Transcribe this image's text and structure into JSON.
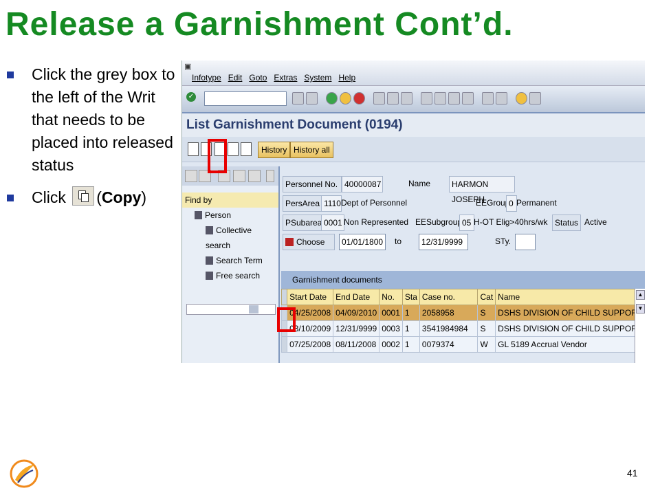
{
  "slide": {
    "title": "Release a Garnishment Cont’d.",
    "bullet1": "Click the grey box to the left of the Writ that needs to be placed into released status",
    "bullet2_pre": "Click ",
    "bullet2_paren_open": "(",
    "bullet2_bold": "Copy",
    "bullet2_paren_close": ")",
    "page_number": "41"
  },
  "sap": {
    "menu": [
      "Infotype",
      "Edit",
      "Goto",
      "Extras",
      "System",
      "Help"
    ],
    "screen_title": "List Garnishment Document (0194)",
    "app_buttons": {
      "history": "History",
      "history_all": "History all"
    },
    "navigator": {
      "find_by": "Find by",
      "person": "Person",
      "items": [
        "Collective search",
        "Search Term",
        "Free search"
      ]
    },
    "header": {
      "personnel_no_label": "Personnel No.",
      "personnel_no": "40000087",
      "name_label": "Name",
      "name": "HARMON JOSEPH",
      "persarea_label": "PersArea",
      "persarea_code": "1110",
      "persarea_text": "Dept of Personnel",
      "eegroup_label": "EEGroup",
      "eegroup_code": "0",
      "eegroup_text": "Permanent",
      "psubarea_label": "PSubarea",
      "psubarea_code": "0001",
      "psubarea_text": "Non Represented",
      "eesubgroup_label": "EESubgroup",
      "eesubgroup_code": "05",
      "eesubgroup_text": "H-OT Elig>40hrs/wk",
      "status_label": "Status",
      "status_value": "Active",
      "choose_label": "Choose",
      "from_date": "01/01/1800",
      "to_label": "to",
      "to_date": "12/31/9999",
      "sty_label": "STy."
    },
    "table": {
      "title": "Garnishment documents",
      "columns": [
        "Start Date",
        "End Date",
        "No.",
        "Sta",
        "Case no.",
        "Cat",
        "Name"
      ],
      "rows": [
        [
          "04/25/2008",
          "04/09/2010",
          "0001",
          "1",
          "2058958",
          "S",
          "DSHS DIVISION OF CHILD SUPPORT"
        ],
        [
          "03/10/2009",
          "12/31/9999",
          "0003",
          "1",
          "3541984984",
          "S",
          "DSHS DIVISION OF CHILD SUPPORT"
        ],
        [
          "07/25/2008",
          "08/11/2008",
          "0002",
          "1",
          "0079374",
          "W",
          "GL 5189 Accrual Vendor"
        ]
      ]
    }
  },
  "colors": {
    "title_green": "#158a22",
    "highlight_red": "#e80000",
    "selected_row": "#d8a95a"
  }
}
